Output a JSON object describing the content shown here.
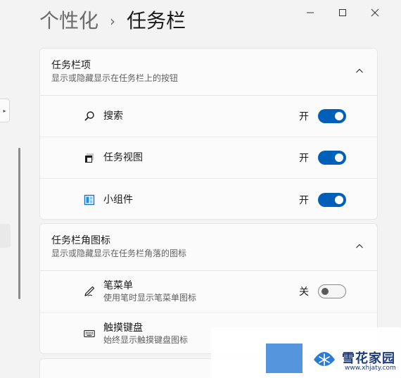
{
  "breadcrumb": {
    "parent": "个性化",
    "separator": "›",
    "current": "任务栏"
  },
  "sections": [
    {
      "title": "任务栏项",
      "subtitle": "显示或隐藏显示在任务栏上的按钮",
      "items": [
        {
          "label": "搜索",
          "state": "开",
          "on": true,
          "icon": "search-icon"
        },
        {
          "label": "任务视图",
          "state": "开",
          "on": true,
          "icon": "task-view-icon"
        },
        {
          "label": "小组件",
          "state": "开",
          "on": true,
          "icon": "widgets-icon"
        }
      ]
    },
    {
      "title": "任务栏角图标",
      "subtitle": "显示或隐藏显示在任务栏角落的图标",
      "items": [
        {
          "label": "笔菜单",
          "sub": "使用笔时显示笔菜单图标",
          "state": "关",
          "on": false,
          "icon": "pen-icon"
        },
        {
          "label": "触摸键盘",
          "sub": "始终显示触摸键盘图标",
          "icon": "keyboard-icon"
        }
      ]
    }
  ],
  "watermark": {
    "name": "雪花家园",
    "url": "www.xhjaty.com"
  },
  "colors": {
    "accent": "#005fb8",
    "background": "#f3f3f3",
    "card": "#fbfbfb"
  }
}
